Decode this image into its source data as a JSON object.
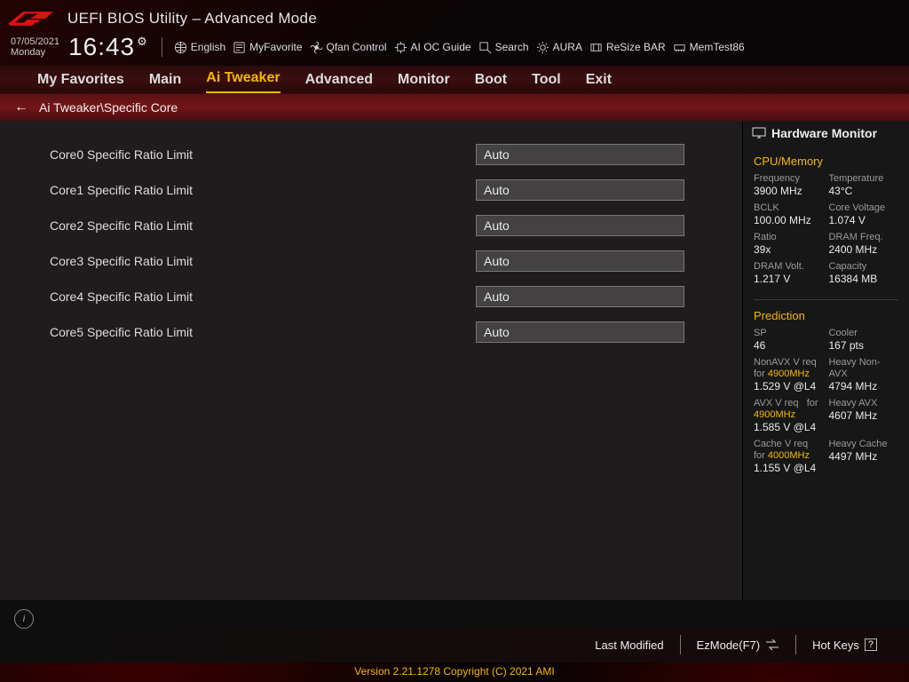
{
  "title": "UEFI BIOS Utility – Advanced Mode",
  "date": "07/05/2021",
  "day": "Monday",
  "time": "16:43",
  "toolbar": {
    "english": "English",
    "favorite": "MyFavorite",
    "qfan": "Qfan Control",
    "aioc": "AI OC Guide",
    "search": "Search",
    "aura": "AURA",
    "resize": "ReSize BAR",
    "memtest": "MemTest86"
  },
  "tabs": [
    "My Favorites",
    "Main",
    "Ai Tweaker",
    "Advanced",
    "Monitor",
    "Boot",
    "Tool",
    "Exit"
  ],
  "tabs_active": 2,
  "breadcrumb": "Ai Tweaker\\Specific Core",
  "rows": [
    {
      "label": "Core0 Specific Ratio Limit",
      "value": "Auto"
    },
    {
      "label": "Core1 Specific Ratio Limit",
      "value": "Auto"
    },
    {
      "label": "Core2 Specific Ratio Limit",
      "value": "Auto"
    },
    {
      "label": "Core3 Specific Ratio Limit",
      "value": "Auto"
    },
    {
      "label": "Core4 Specific Ratio Limit",
      "value": "Auto"
    },
    {
      "label": "Core5 Specific Ratio Limit",
      "value": "Auto"
    }
  ],
  "hw": {
    "title": "Hardware Monitor",
    "cpu_section": "CPU/Memory",
    "freq_l": "Frequency",
    "freq_v": "3900 MHz",
    "temp_l": "Temperature",
    "temp_v": "43°C",
    "bclk_l": "BCLK",
    "bclk_v": "100.00 MHz",
    "cvol_l": "Core Voltage",
    "cvol_v": "1.074 V",
    "ratio_l": "Ratio",
    "ratio_v": "39x",
    "dramf_l": "DRAM Freq.",
    "dramf_v": "2400 MHz",
    "dramv_l": "DRAM Volt.",
    "dramv_v": "1.217 V",
    "cap_l": "Capacity",
    "cap_v": "16384 MB",
    "pred_section": "Prediction",
    "sp_l": "SP",
    "sp_v": "46",
    "cool_l": "Cooler",
    "cool_v": "167 pts",
    "navx_l1": "NonAVX V req",
    "navx_l2": "for ",
    "navx_hz": "4900MHz",
    "navx_v": "1.529 V @L4",
    "hna_l": "Heavy Non-AVX",
    "hna_v": "4794 MHz",
    "avx_l1": "AVX V req",
    "avx_l2": "for",
    "avx_hz": "4900MHz",
    "avx_v": "1.585 V @L4",
    "havx_l": "Heavy AVX",
    "havx_v": "4607 MHz",
    "cache_l1": "Cache V req",
    "cache_l2": "for ",
    "cache_hz": "4000MHz",
    "cache_v": "1.155 V @L4",
    "hcache_l": "Heavy Cache",
    "hcache_v": "4497 MHz"
  },
  "footer": {
    "lastmod": "Last Modified",
    "ezmode": "EzMode(F7)",
    "hotkeys": "Hot Keys",
    "copyright": "Version 2.21.1278 Copyright (C) 2021 AMI"
  }
}
